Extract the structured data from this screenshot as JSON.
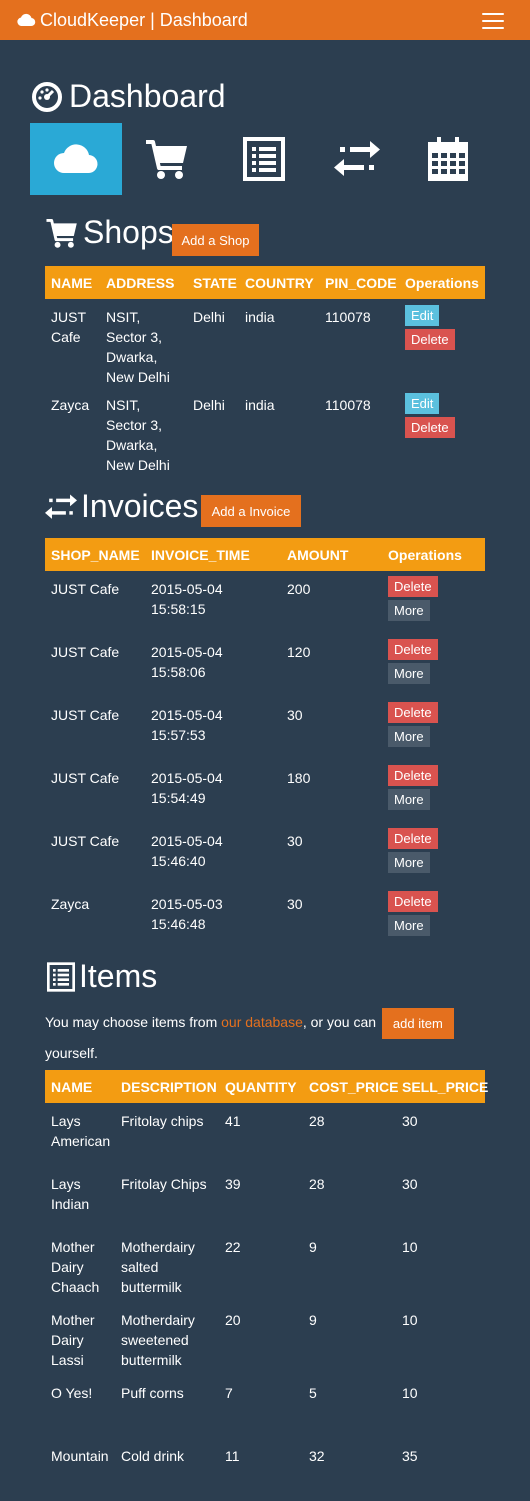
{
  "header": {
    "title": "CloudKeeper | Dashboard"
  },
  "page": {
    "title": "Dashboard"
  },
  "nav": [
    "cloud",
    "cart",
    "list",
    "exchange",
    "calendar"
  ],
  "shops": {
    "title": "Shops",
    "add_label": "Add a Shop",
    "columns": [
      "NAME",
      "ADDRESS",
      "STATE",
      "COUNTRY",
      "PIN_CODE",
      "Operations"
    ],
    "rows": [
      {
        "name": "JUST Cafe",
        "address": "NSIT, Sector 3, Dwarka, New Delhi",
        "state": "Delhi",
        "country": "india",
        "pin": "110078"
      },
      {
        "name": "Zayca",
        "address": "NSIT, Sector 3, Dwarka, New Delhi",
        "state": "Delhi",
        "country": "india",
        "pin": "110078"
      }
    ],
    "edit_label": "Edit",
    "delete_label": "Delete"
  },
  "invoices": {
    "title": "Invoices",
    "add_label": "Add a Invoice",
    "columns": [
      "SHOP_NAME",
      "INVOICE_TIME",
      "AMOUNT",
      "Operations"
    ],
    "rows": [
      {
        "shop": "JUST Cafe",
        "date": "2015-05-04",
        "time": "15:58:15",
        "amount": "200"
      },
      {
        "shop": "JUST Cafe",
        "date": "2015-05-04",
        "time": "15:58:06",
        "amount": "120"
      },
      {
        "shop": "JUST Cafe",
        "date": "2015-05-04",
        "time": "15:57:53",
        "amount": "30"
      },
      {
        "shop": "JUST Cafe",
        "date": "2015-05-04",
        "time": "15:54:49",
        "amount": "180"
      },
      {
        "shop": "JUST Cafe",
        "date": "2015-05-04",
        "time": "15:46:40",
        "amount": "30"
      },
      {
        "shop": "Zayca",
        "date": "2015-05-03",
        "time": "15:46:48",
        "amount": "30"
      }
    ],
    "delete_label": "Delete",
    "more_label": "More"
  },
  "items": {
    "title": "Items",
    "intro_before": "You may choose items from ",
    "intro_link": "our database",
    "intro_middle": ", or you can ",
    "add_label": "add item",
    "intro_after": "yourself.",
    "columns": [
      "NAME",
      "DESCRIPTION",
      "QUANTITY",
      "COST_PRICE",
      "SELL_PRICE"
    ],
    "rows": [
      {
        "name": "Lays American",
        "description": "Fritolay chips",
        "quantity": "41",
        "cost": "28",
        "sell": "30"
      },
      {
        "name": "Lays Indian",
        "description": "Fritolay Chips",
        "quantity": "39",
        "cost": "28",
        "sell": "30"
      },
      {
        "name": "Mother Dairy Chaach",
        "description": "Motherdairy salted buttermilk",
        "quantity": "22",
        "cost": "9",
        "sell": "10"
      },
      {
        "name": "Mother Dairy Lassi",
        "description": "Motherdairy sweetened buttermilk",
        "quantity": "20",
        "cost": "9",
        "sell": "10"
      },
      {
        "name": "O Yes!",
        "description": "Puff corns",
        "quantity": "7",
        "cost": "5",
        "sell": "10"
      },
      {
        "name": "Mountain",
        "description": "Cold drink",
        "quantity": "11",
        "cost": "32",
        "sell": "35"
      }
    ]
  }
}
